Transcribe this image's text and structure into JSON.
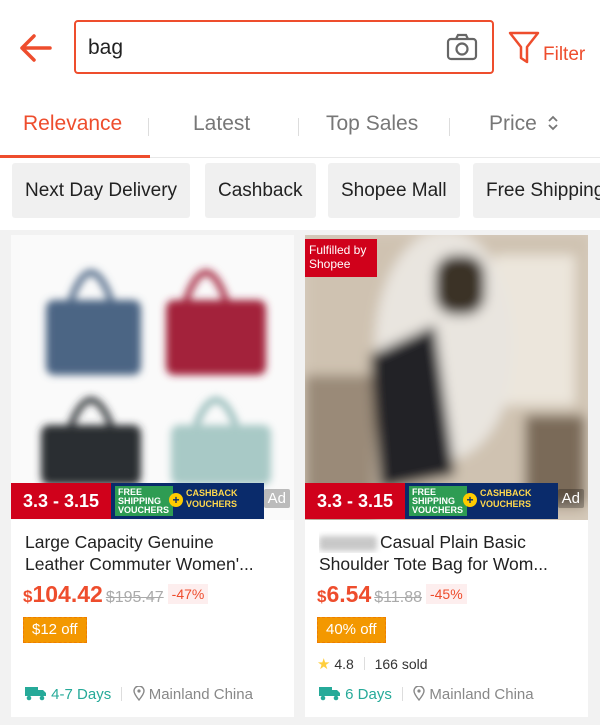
{
  "search": {
    "query": "bag",
    "filter_label": "Filter"
  },
  "sort_tabs": [
    "Relevance",
    "Latest",
    "Top Sales",
    "Price"
  ],
  "chips": [
    "Next Day Delivery",
    "Cashback",
    "Shopee Mall",
    "Free Shipping"
  ],
  "products": [
    {
      "promo_dates": "3.3 - 3.15",
      "free_shipping": "FREE SHIPPING VOUCHERS",
      "cashback": "CASHBACK VOUCHERS",
      "ad": "Ad",
      "title_line1": "Large Capacity Genuine",
      "title_line2": "Leather Commuter Women'...",
      "currency": "$",
      "price": "104.42",
      "original_price": "$195.47",
      "discount": "-47%",
      "voucher": "$12 off",
      "delivery": "4-7 Days",
      "location": "Mainland China"
    },
    {
      "fulfilled": "Fulfilled by Shopee",
      "promo_dates": "3.3 - 3.15",
      "free_shipping": "FREE SHIPPING VOUCHERS",
      "cashback": "CASHBACK VOUCHERS",
      "ad": "Ad",
      "title_line1": "Casual Plain Basic",
      "title_line2": "Shoulder Tote Bag for Wom...",
      "currency": "$",
      "price": "6.54",
      "original_price": "$11.88",
      "discount": "-45%",
      "voucher": "40% off",
      "rating": "4.8",
      "sold": "166 sold",
      "delivery": "6 Days",
      "location": "Mainland China"
    }
  ],
  "colors": {
    "accent": "#ee4d2d",
    "teal": "#26aa99",
    "promo_red": "#d0011b",
    "voucher_orange": "#f39800"
  }
}
